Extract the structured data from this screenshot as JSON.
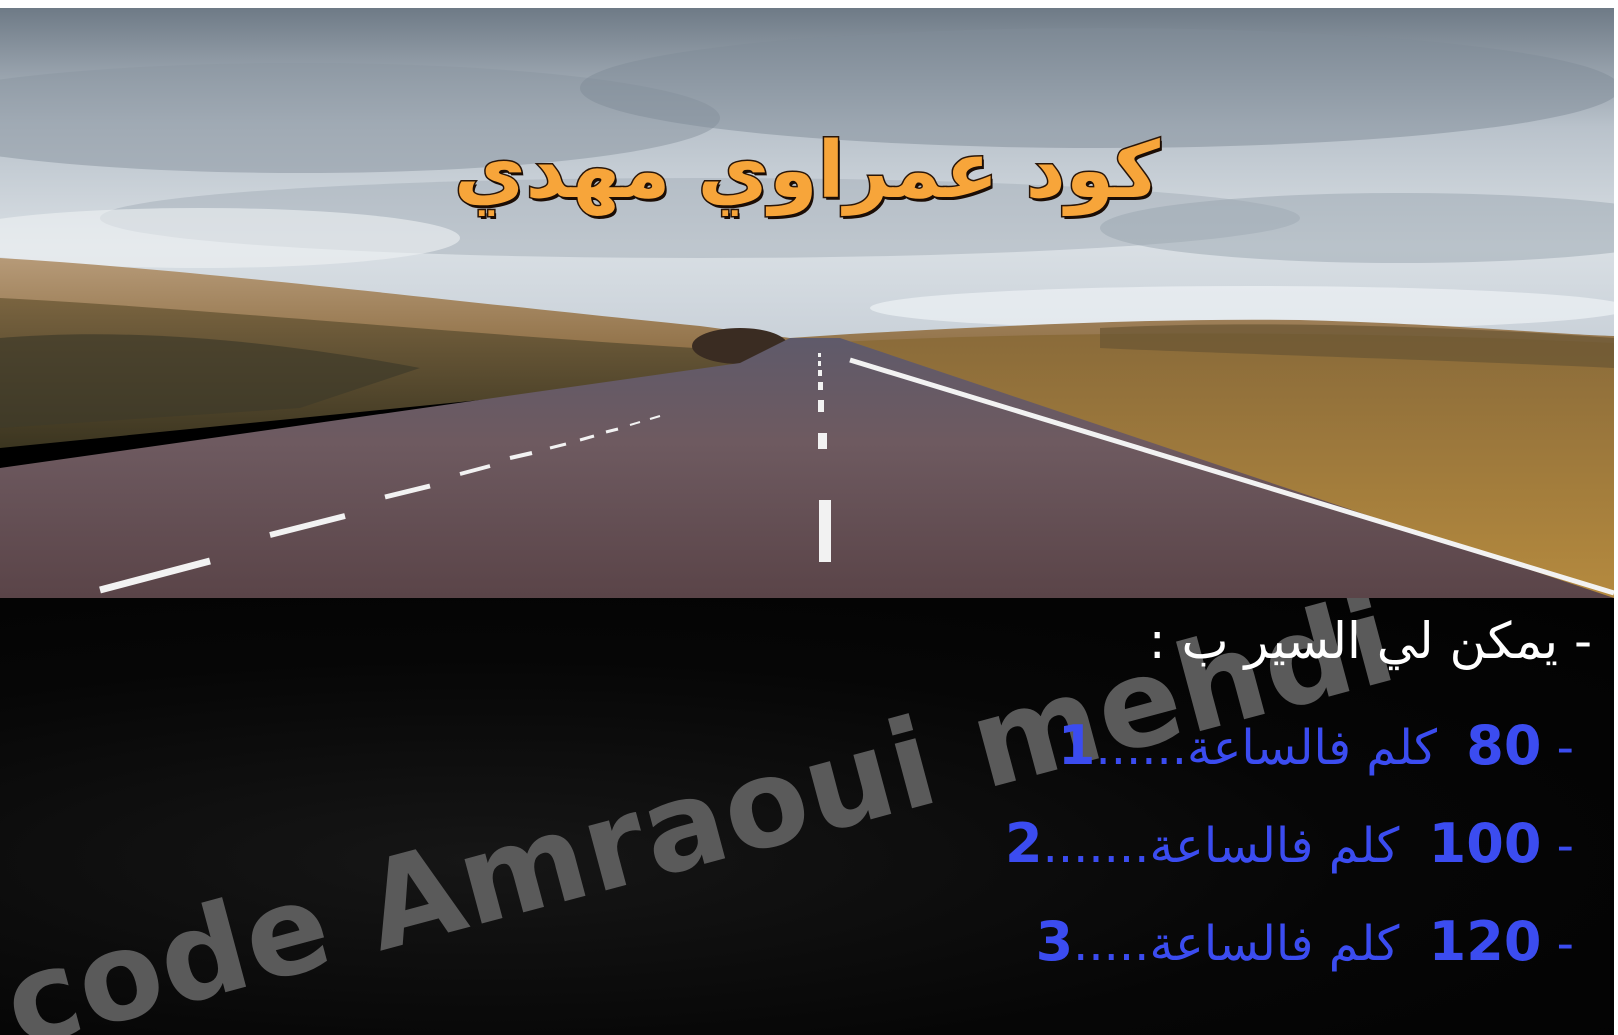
{
  "title": "كود عمراوي مهدي",
  "question": "- يمكن لي السير ب :",
  "options": [
    {
      "prefix": "-",
      "speed": "80",
      "unit": "كلم فالساعة",
      "dots": "......",
      "index": "1"
    },
    {
      "prefix": "-",
      "speed": "100",
      "unit": "كلم فالساعة",
      "dots": ".......",
      "index": "2"
    },
    {
      "prefix": "-",
      "speed": "120",
      "unit": "كلم فالساعة",
      "dots": ".....",
      "index": "3"
    }
  ],
  "watermark": "code Amraoui mehdi",
  "colors": {
    "title": "#f7a53a",
    "option_text": "#3b4cf0",
    "question_text": "#ffffff",
    "watermark": "#5a5a5a",
    "panel_bg": "#040404"
  }
}
